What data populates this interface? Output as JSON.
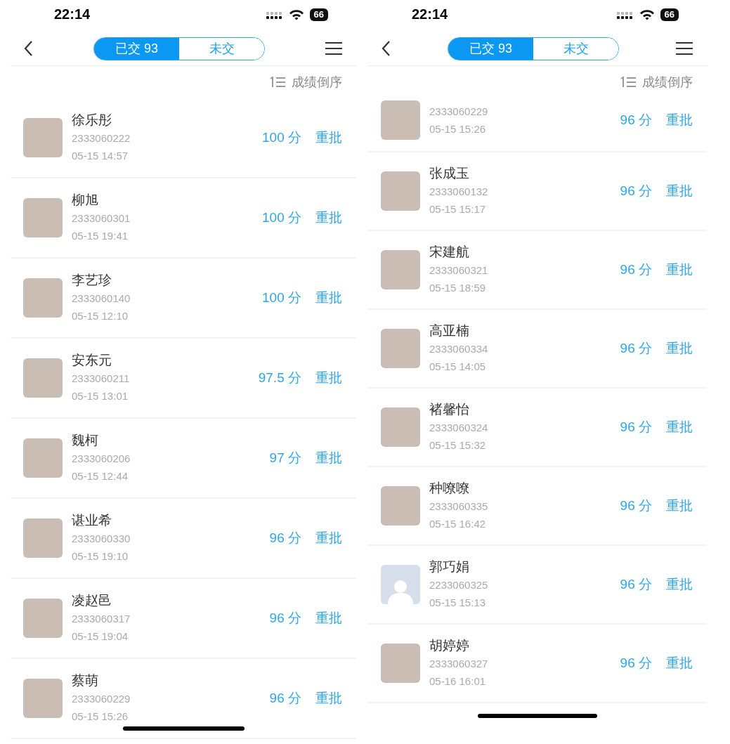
{
  "phones": [
    {
      "status_bar": {
        "time": "22:14",
        "battery": "66"
      },
      "tabs": [
        {
          "label": "已交 93",
          "selected": true
        },
        {
          "label": "未交",
          "selected": false
        }
      ],
      "sort_label": "成绩倒序",
      "rows": [
        {
          "kind": "full",
          "avatar": {
            "kind": "photo"
          },
          "name": "徐乐彤",
          "student_id": "2333060222",
          "submitted_at": "05-15 14:57",
          "score": "100 分",
          "action": "重批"
        },
        {
          "kind": "full",
          "avatar": {
            "kind": "photo"
          },
          "name": "柳旭",
          "student_id": "2333060301",
          "submitted_at": "05-15 19:41",
          "score": "100 分",
          "action": "重批"
        },
        {
          "kind": "full",
          "avatar": {
            "kind": "photo"
          },
          "name": "李艺珍",
          "student_id": "2333060140",
          "submitted_at": "05-15 12:10",
          "score": "100 分",
          "action": "重批"
        },
        {
          "kind": "full",
          "avatar": {
            "kind": "photo"
          },
          "name": "安东元",
          "student_id": "2333060211",
          "submitted_at": "05-15 13:01",
          "score": "97.5 分",
          "action": "重批"
        },
        {
          "kind": "full",
          "avatar": {
            "kind": "photo"
          },
          "name": "魏柯",
          "student_id": "2333060206",
          "submitted_at": "05-15 12:44",
          "score": "97 分",
          "action": "重批"
        },
        {
          "kind": "full",
          "avatar": {
            "kind": "photo"
          },
          "name": "谌业希",
          "student_id": "2333060330",
          "submitted_at": "05-15 19:10",
          "score": "96 分",
          "action": "重批"
        },
        {
          "kind": "full",
          "avatar": {
            "kind": "photo"
          },
          "name": "凌赵邑",
          "student_id": "2333060317",
          "submitted_at": "05-15 19:04",
          "score": "96 分",
          "action": "重批"
        },
        {
          "kind": "full",
          "avatar": {
            "kind": "photo"
          },
          "name": "蔡萌",
          "student_id": "2333060229",
          "submitted_at": "05-15 15:26",
          "score": "96 分",
          "action": "重批"
        }
      ]
    },
    {
      "status_bar": {
        "time": "22:14",
        "battery": "66"
      },
      "tabs": [
        {
          "label": "已交 93",
          "selected": true
        },
        {
          "label": "未交",
          "selected": false
        }
      ],
      "sort_label": "成绩倒序",
      "rows": [
        {
          "kind": "clipped",
          "avatar": {
            "kind": "photo"
          },
          "student_id": "2333060229",
          "submitted_at": "05-15 15:26",
          "score": "96 分",
          "action": "重批"
        },
        {
          "kind": "full",
          "avatar": {
            "kind": "photo"
          },
          "name": "张成玉",
          "student_id": "2333060132",
          "submitted_at": "05-15 15:17",
          "score": "96 分",
          "action": "重批"
        },
        {
          "kind": "full",
          "avatar": {
            "kind": "photo"
          },
          "name": "宋建航",
          "student_id": "2333060321",
          "submitted_at": "05-15 18:59",
          "score": "96 分",
          "action": "重批"
        },
        {
          "kind": "full",
          "avatar": {
            "kind": "photo"
          },
          "name": "高亚楠",
          "student_id": "2333060334",
          "submitted_at": "05-15 14:05",
          "score": "96 分",
          "action": "重批"
        },
        {
          "kind": "full",
          "avatar": {
            "kind": "photo"
          },
          "name": "褚馨怡",
          "student_id": "2333060324",
          "submitted_at": "05-15 15:32",
          "score": "96 分",
          "action": "重批"
        },
        {
          "kind": "full",
          "avatar": {
            "kind": "photo"
          },
          "name": "种嘹嘹",
          "student_id": "2333060335",
          "submitted_at": "05-15 16:42",
          "score": "96 分",
          "action": "重批"
        },
        {
          "kind": "full",
          "avatar": {
            "kind": "default"
          },
          "name": "郭巧娟",
          "student_id": "2233060325",
          "submitted_at": "05-15 15:13",
          "score": "96 分",
          "action": "重批"
        },
        {
          "kind": "full",
          "avatar": {
            "kind": "photo"
          },
          "name": "胡婷婷",
          "student_id": "2333060327",
          "submitted_at": "05-16 16:01",
          "score": "96 分",
          "action": "重批"
        }
      ]
    }
  ]
}
